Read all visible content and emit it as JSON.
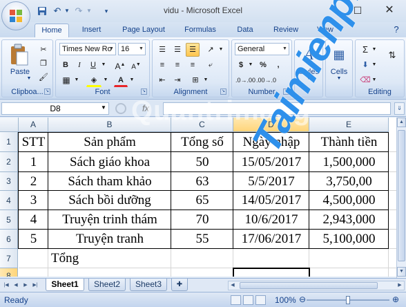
{
  "window": {
    "title": "vidu - Microsoft Excel",
    "minimize_icon": "minimize-icon",
    "maximize_icon": "maximize-icon",
    "close_icon": "close-icon"
  },
  "quick_access": [
    "save-icon",
    "undo-icon",
    "redo-icon",
    "customize-icon"
  ],
  "tabs": [
    {
      "label": "Home",
      "active": true
    },
    {
      "label": "Insert"
    },
    {
      "label": "Page Layout"
    },
    {
      "label": "Formulas"
    },
    {
      "label": "Data"
    },
    {
      "label": "Review"
    },
    {
      "label": "View"
    }
  ],
  "ribbon": {
    "clipboard": {
      "label": "Clipboa...",
      "paste_label": "Paste"
    },
    "font": {
      "label": "Font",
      "name": "Times New Ro",
      "size": "16",
      "bold": "B",
      "italic": "I",
      "underline": "U"
    },
    "alignment": {
      "label": "Alignment"
    },
    "number": {
      "label": "Number",
      "format": "General",
      "currency": "$",
      "percent": "%",
      "comma": ","
    },
    "styles": {
      "label": "Styles"
    },
    "cells": {
      "label": "Cells"
    },
    "editing": {
      "label": "Editing"
    }
  },
  "formula_bar": {
    "name_box": "D8",
    "fx": "fx",
    "content": ""
  },
  "grid": {
    "columns": [
      "A",
      "B",
      "C",
      "D",
      "E"
    ],
    "rows": [
      "1",
      "2",
      "3",
      "4",
      "5",
      "6",
      "7",
      "8"
    ],
    "active_col": "D",
    "active_row": "8",
    "header": [
      "STT",
      "Sản phẩm",
      "Tổng số",
      "Ngày nhập",
      "Thành tiền"
    ],
    "data": [
      [
        "1",
        "Sách giáo khoa",
        "50",
        "15/05/2017",
        "1,500,000"
      ],
      [
        "2",
        "Sách tham khảo",
        "63",
        "5/5/2017",
        "3,750,00"
      ],
      [
        "3",
        "Sách bồi dưỡng",
        "65",
        "14/05/2017",
        "4,500,000"
      ],
      [
        "4",
        "Truyện trinh thám",
        "70",
        "10/6/2017",
        "2,943,000"
      ],
      [
        "5",
        "Truyện tranh",
        "55",
        "17/06/2017",
        "5,100,000"
      ]
    ],
    "total_label": "Tổng"
  },
  "sheets": [
    {
      "label": "Sheet1",
      "active": true
    },
    {
      "label": "Sheet2"
    },
    {
      "label": "Sheet3"
    }
  ],
  "status": {
    "text": "Ready",
    "zoom": "100%",
    "zoom_fraction": 0.5
  },
  "watermark": {
    "text": "Quantrimang",
    "blue": "Taimienphi.vn"
  }
}
